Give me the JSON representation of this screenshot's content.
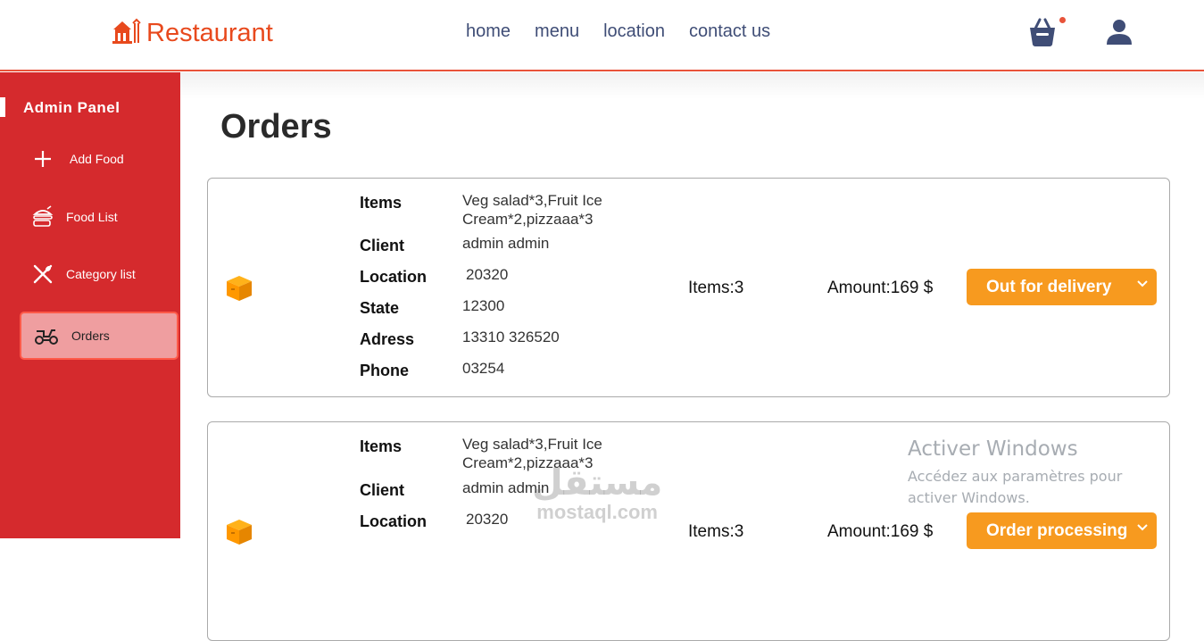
{
  "app": {
    "brand": "Restaurant",
    "accent": "#e8491d",
    "nav": [
      "home",
      "menu",
      "location",
      "contact us"
    ]
  },
  "sidebar": {
    "title": "Admin Panel",
    "items": [
      {
        "label": "Add Food",
        "icon": "plus-icon"
      },
      {
        "label": "Food List",
        "icon": "food-list-icon"
      },
      {
        "label": "Category list",
        "icon": "utensils-icon"
      },
      {
        "label": "Orders",
        "icon": "scooter-icon",
        "active": true
      }
    ]
  },
  "main": {
    "title": "Orders",
    "field_labels": {
      "items": "Items",
      "client": "Client",
      "location": "Location",
      "state": "State",
      "address": "Adress",
      "phone": "Phone"
    },
    "orders": [
      {
        "items": "Veg salad*3,Fruit Ice Cream*2,pizzaaa*3",
        "client": "admin admin",
        "location": "20320",
        "state": "12300",
        "address": "13310 326520",
        "phone": "03254",
        "items_count": "Items:3",
        "amount": "Amount:169 $",
        "status": "Out for delivery"
      },
      {
        "items": "Veg salad*3,Fruit Ice Cream*2,pizzaaa*3",
        "client": "admin admin",
        "location": "20320",
        "items_count": "Items:3",
        "amount": "Amount:169 $",
        "status": "Order processing"
      }
    ]
  },
  "overlay": {
    "activation_title": "Activer Windows",
    "activation_text": "Accédez aux paramètres pour activer Windows.",
    "brand_watermark_ar": "مستقل",
    "brand_watermark_latin": "mostaql.com"
  }
}
